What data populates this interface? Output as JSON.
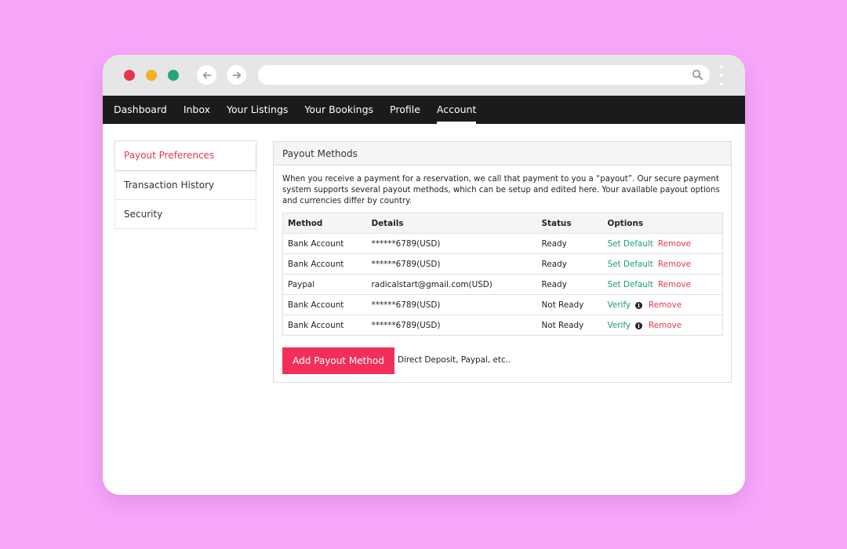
{
  "browser": {
    "url": "",
    "controls": {
      "close": "red",
      "minimize": "yellow",
      "maximize": "green"
    }
  },
  "nav": {
    "items": [
      {
        "label": "Dashboard",
        "active": false
      },
      {
        "label": "Inbox",
        "active": false
      },
      {
        "label": "Your Listings",
        "active": false
      },
      {
        "label": "Your Bookings",
        "active": false
      },
      {
        "label": "Profile",
        "active": false
      },
      {
        "label": "Account",
        "active": true
      }
    ]
  },
  "sidebar": {
    "items": [
      {
        "label": "Payout Preferences",
        "active": true
      },
      {
        "label": "Transaction History",
        "active": false
      },
      {
        "label": "Security",
        "active": false
      }
    ]
  },
  "panel": {
    "title": "Payout Methods",
    "description": "When you receive a payment for a reservation, we call that payment to you a “payout”. Our secure payment system supports several payout methods, which can be setup and edited here. Your available payout options and currencies differ by country.",
    "table": {
      "headers": [
        "Method",
        "Details",
        "Status",
        "Options"
      ],
      "rows": [
        {
          "method": "Bank Account",
          "details": "******6789(USD)",
          "status": "Ready",
          "primary_option": "Set Default",
          "remove": "Remove",
          "info": false
        },
        {
          "method": "Bank Account",
          "details": "******6789(USD)",
          "status": "Ready",
          "primary_option": "Set Default",
          "remove": "Remove",
          "info": false
        },
        {
          "method": "Paypal",
          "details": "radicalstart@gmail.com(USD)",
          "status": "Ready",
          "primary_option": "Set Default",
          "remove": "Remove",
          "info": false
        },
        {
          "method": "Bank Account",
          "details": "******6789(USD)",
          "status": "Not Ready",
          "primary_option": "Verify",
          "remove": "Remove",
          "info": true
        },
        {
          "method": "Bank Account",
          "details": "******6789(USD)",
          "status": "Not Ready",
          "primary_option": "Verify",
          "remove": "Remove",
          "info": true
        }
      ]
    },
    "add_button": "Add Payout Method",
    "add_hint": "Direct Deposit, Paypal, etc.."
  },
  "colors": {
    "background": "#f7a8fb",
    "accent_red": "#e8364a",
    "button_pink": "#f0305a",
    "link_green": "#1b9a7c",
    "nav_dark": "#1b1b1b"
  },
  "icons": {
    "back": "arrow-left-icon",
    "forward": "arrow-right-icon",
    "search": "search-icon",
    "menu": "kebab-menu-icon",
    "info": "info-icon"
  }
}
